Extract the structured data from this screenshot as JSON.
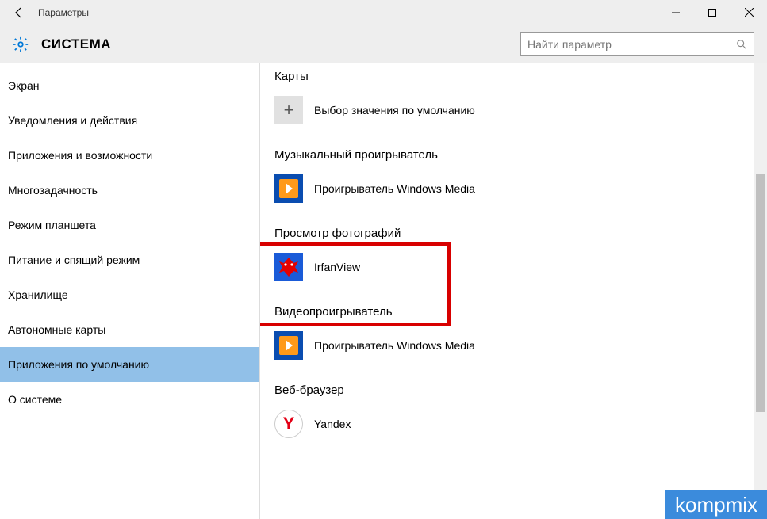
{
  "titlebar": {
    "title": "Параметры"
  },
  "header": {
    "section": "СИСТЕМА",
    "search_placeholder": "Найти параметр"
  },
  "sidebar": {
    "items": [
      "Экран",
      "Уведомления и действия",
      "Приложения и возможности",
      "Многозадачность",
      "Режим планшета",
      "Питание и спящий режим",
      "Хранилище",
      "Автономные карты",
      "Приложения по умолчанию",
      "О системе"
    ],
    "selected_index": 8
  },
  "groups": [
    {
      "title": "Карты",
      "app": "Выбор значения по умолчанию",
      "icon": "plus"
    },
    {
      "title": "Музыкальный проигрыватель",
      "app": "Проигрыватель Windows Media",
      "icon": "wmp"
    },
    {
      "title": "Просмотр фотографий",
      "app": "IrfanView",
      "icon": "irfan",
      "highlight": true
    },
    {
      "title": "Видеопроигрыватель",
      "app": "Проигрыватель Windows Media",
      "icon": "wmp"
    },
    {
      "title": "Веб-браузер",
      "app": "Yandex",
      "icon": "yandex"
    }
  ],
  "watermark": "kompmix"
}
